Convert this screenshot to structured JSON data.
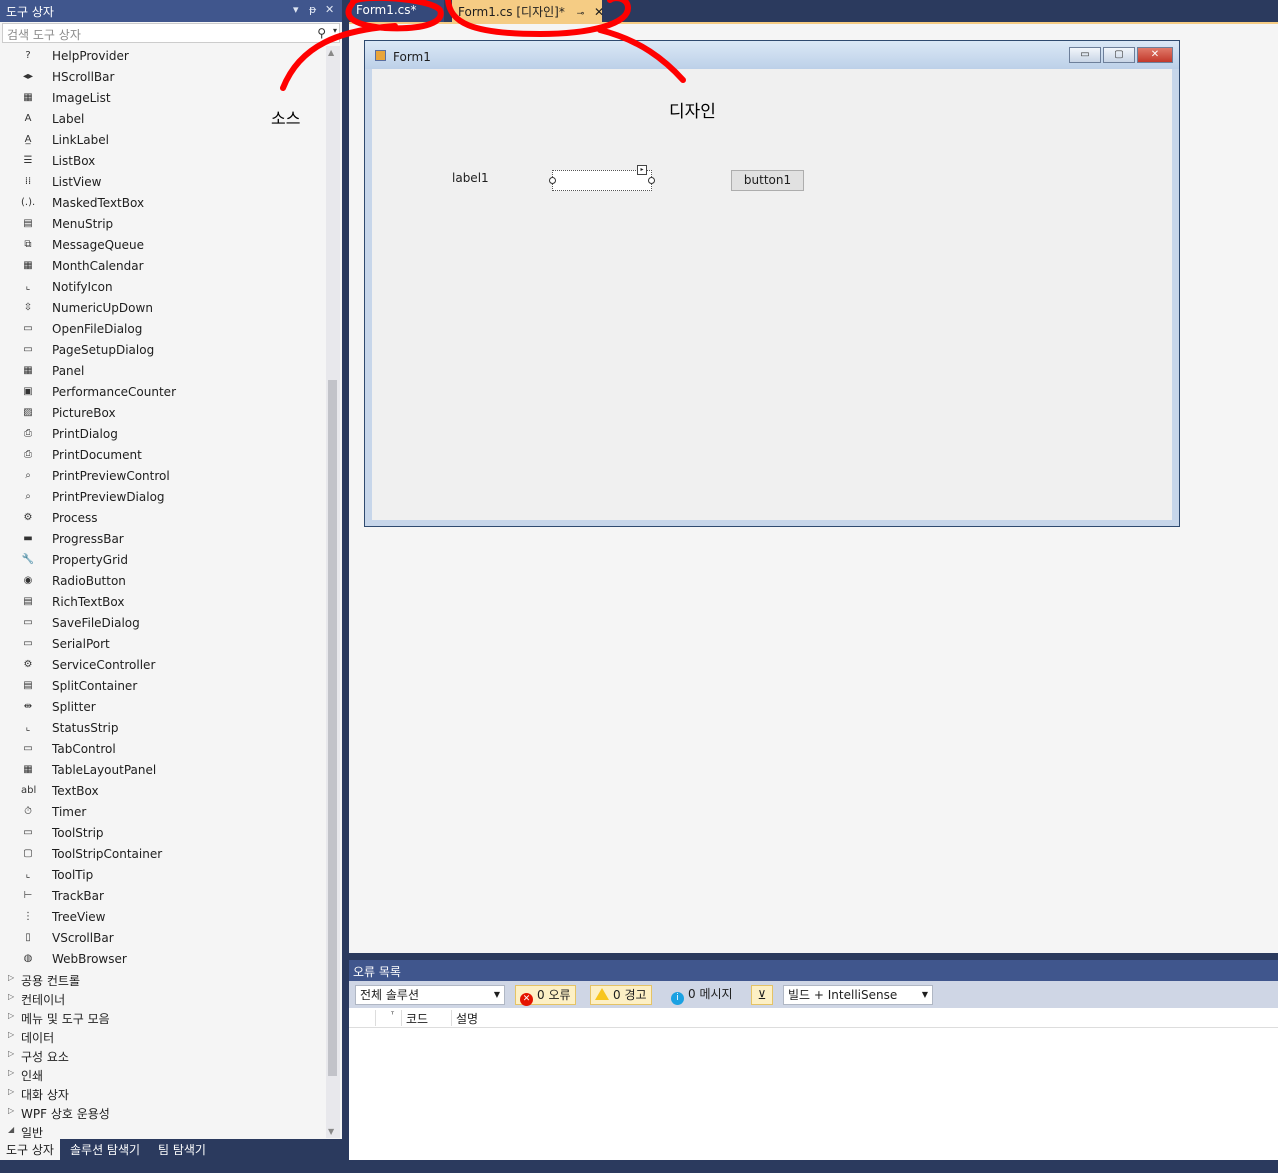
{
  "toolbox": {
    "title": "도구 상자",
    "controls": {
      "dropdown": "▾",
      "pin": "ᵽ",
      "close": "✕"
    },
    "search_placeholder": "검색 도구 상자",
    "search_icon": "⚲",
    "items": [
      {
        "label": "HelpProvider",
        "icon": "help-provider-icon",
        "glyph": "?"
      },
      {
        "label": "HScrollBar",
        "icon": "hscrollbar-icon",
        "glyph": "◂▸"
      },
      {
        "label": "ImageList",
        "icon": "imagelist-icon",
        "glyph": "▦"
      },
      {
        "label": "Label",
        "icon": "label-icon",
        "glyph": "A"
      },
      {
        "label": "LinkLabel",
        "icon": "linklabel-icon",
        "glyph": "A̲"
      },
      {
        "label": "ListBox",
        "icon": "listbox-icon",
        "glyph": "☰"
      },
      {
        "label": "ListView",
        "icon": "listview-icon",
        "glyph": "⁞⁞"
      },
      {
        "label": "MaskedTextBox",
        "icon": "maskedtextbox-icon",
        "glyph": "(.)."
      },
      {
        "label": "MenuStrip",
        "icon": "menustrip-icon",
        "glyph": "▤"
      },
      {
        "label": "MessageQueue",
        "icon": "messagequeue-icon",
        "glyph": "⧉"
      },
      {
        "label": "MonthCalendar",
        "icon": "monthcalendar-icon",
        "glyph": "▦"
      },
      {
        "label": "NotifyIcon",
        "icon": "notifyicon-icon",
        "glyph": "⌞"
      },
      {
        "label": "NumericUpDown",
        "icon": "numericupdown-icon",
        "glyph": "⇳"
      },
      {
        "label": "OpenFileDialog",
        "icon": "openfiledialog-icon",
        "glyph": "▭"
      },
      {
        "label": "PageSetupDialog",
        "icon": "pagesetupdialog-icon",
        "glyph": "▭"
      },
      {
        "label": "Panel",
        "icon": "panel-icon",
        "glyph": "▦"
      },
      {
        "label": "PerformanceCounter",
        "icon": "performancecounter-icon",
        "glyph": "▣"
      },
      {
        "label": "PictureBox",
        "icon": "picturebox-icon",
        "glyph": "▨"
      },
      {
        "label": "PrintDialog",
        "icon": "printdialog-icon",
        "glyph": "⎙"
      },
      {
        "label": "PrintDocument",
        "icon": "printdocument-icon",
        "glyph": "⎙"
      },
      {
        "label": "PrintPreviewControl",
        "icon": "printpreviewcontrol-icon",
        "glyph": "⌕"
      },
      {
        "label": "PrintPreviewDialog",
        "icon": "printpreviewdialog-icon",
        "glyph": "⌕"
      },
      {
        "label": "Process",
        "icon": "process-icon",
        "glyph": "⚙"
      },
      {
        "label": "ProgressBar",
        "icon": "progressbar-icon",
        "glyph": "▬"
      },
      {
        "label": "PropertyGrid",
        "icon": "propertygrid-icon",
        "glyph": "🔧"
      },
      {
        "label": "RadioButton",
        "icon": "radiobutton-icon",
        "glyph": "◉"
      },
      {
        "label": "RichTextBox",
        "icon": "richtextbox-icon",
        "glyph": "▤"
      },
      {
        "label": "SaveFileDialog",
        "icon": "savefiledialog-icon",
        "glyph": "▭"
      },
      {
        "label": "SerialPort",
        "icon": "serialport-icon",
        "glyph": "▭"
      },
      {
        "label": "ServiceController",
        "icon": "servicecontroller-icon",
        "glyph": "⚙"
      },
      {
        "label": "SplitContainer",
        "icon": "splitcontainer-icon",
        "glyph": "▤"
      },
      {
        "label": "Splitter",
        "icon": "splitter-icon",
        "glyph": "⇹"
      },
      {
        "label": "StatusStrip",
        "icon": "statusstrip-icon",
        "glyph": "⌞"
      },
      {
        "label": "TabControl",
        "icon": "tabcontrol-icon",
        "glyph": "▭"
      },
      {
        "label": "TableLayoutPanel",
        "icon": "tablelayoutpanel-icon",
        "glyph": "▦"
      },
      {
        "label": "TextBox",
        "icon": "textbox-icon",
        "glyph": "abl"
      },
      {
        "label": "Timer",
        "icon": "timer-icon",
        "glyph": "⏱"
      },
      {
        "label": "ToolStrip",
        "icon": "toolstrip-icon",
        "glyph": "▭"
      },
      {
        "label": "ToolStripContainer",
        "icon": "toolstripcontainer-icon",
        "glyph": "▢"
      },
      {
        "label": "ToolTip",
        "icon": "tooltip-icon",
        "glyph": "⌞"
      },
      {
        "label": "TrackBar",
        "icon": "trackbar-icon",
        "glyph": "⊢"
      },
      {
        "label": "TreeView",
        "icon": "treeview-icon",
        "glyph": "⋮"
      },
      {
        "label": "VScrollBar",
        "icon": "vscrollbar-icon",
        "glyph": "▯"
      },
      {
        "label": "WebBrowser",
        "icon": "webbrowser-icon",
        "glyph": "◍"
      }
    ],
    "groups": [
      {
        "label": "공용 컨트롤",
        "expanded": false
      },
      {
        "label": "컨테이너",
        "expanded": false
      },
      {
        "label": "메뉴 및 도구 모음",
        "expanded": false
      },
      {
        "label": "데이터",
        "expanded": false
      },
      {
        "label": "구성 요소",
        "expanded": false
      },
      {
        "label": "인쇄",
        "expanded": false
      },
      {
        "label": "대화 상자",
        "expanded": false
      },
      {
        "label": "WPF 상호 운용성",
        "expanded": false
      },
      {
        "label": "일반",
        "expanded": true
      }
    ],
    "bottom_tabs": [
      "도구 상자",
      "솔루션 탐색기",
      "팀 탐색기"
    ]
  },
  "doc_tabs": {
    "source_tab": "Form1.cs*",
    "design_tab": "Form1.cs [디자인]*",
    "pin_glyph": "⊸",
    "close_glyph": "✕"
  },
  "form": {
    "title": "Form1",
    "min_glyph": "▭",
    "max_glyph": "▢",
    "close_glyph": "✕",
    "label_text": "label1",
    "button_text": "button1",
    "smart_tag_glyph": "▸"
  },
  "annotations": {
    "source": "소스",
    "design": "디자인",
    "mark_color": "#ff0000"
  },
  "error_list": {
    "title": "오류 목록",
    "scope": "전체 솔루션",
    "errors": "0 오류",
    "warnings": "0 경고",
    "messages": "0 메시지",
    "build_filter": "빌드 + IntelliSense",
    "columns": [
      "코드",
      "설명"
    ]
  },
  "colors": {
    "accent": "#40568d",
    "active_tab": "#f5cc84",
    "background": "#f5f5f5",
    "error": "#e51400",
    "warning": "#f8c51c",
    "info": "#1ba1e2"
  }
}
